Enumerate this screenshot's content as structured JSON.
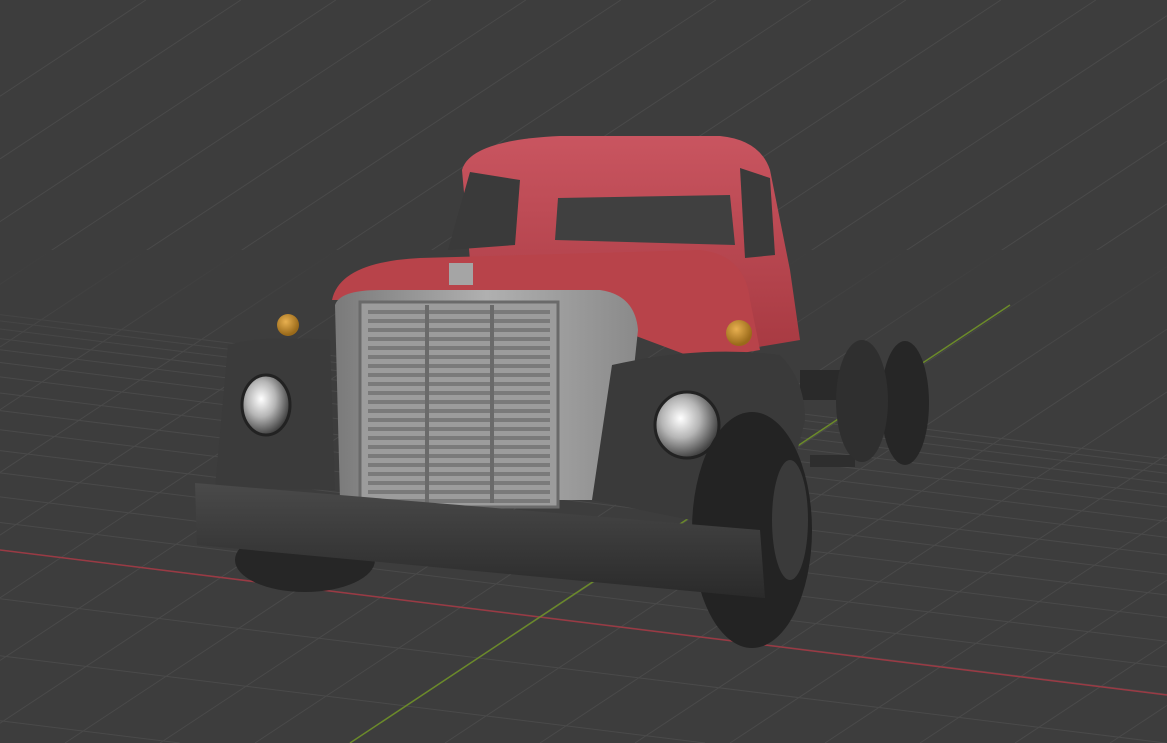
{
  "viewport": {
    "background_color": "#3d3d3d",
    "grid_color": "#4a4a4a",
    "x_axis_color": "#9a3a44",
    "y_axis_color": "#6b8a2a"
  },
  "model": {
    "body_color": "#b8434a",
    "grille_color": "#9a9a9a",
    "fender_color": "#3a3a3a",
    "lamp_color": "#c8922e"
  }
}
